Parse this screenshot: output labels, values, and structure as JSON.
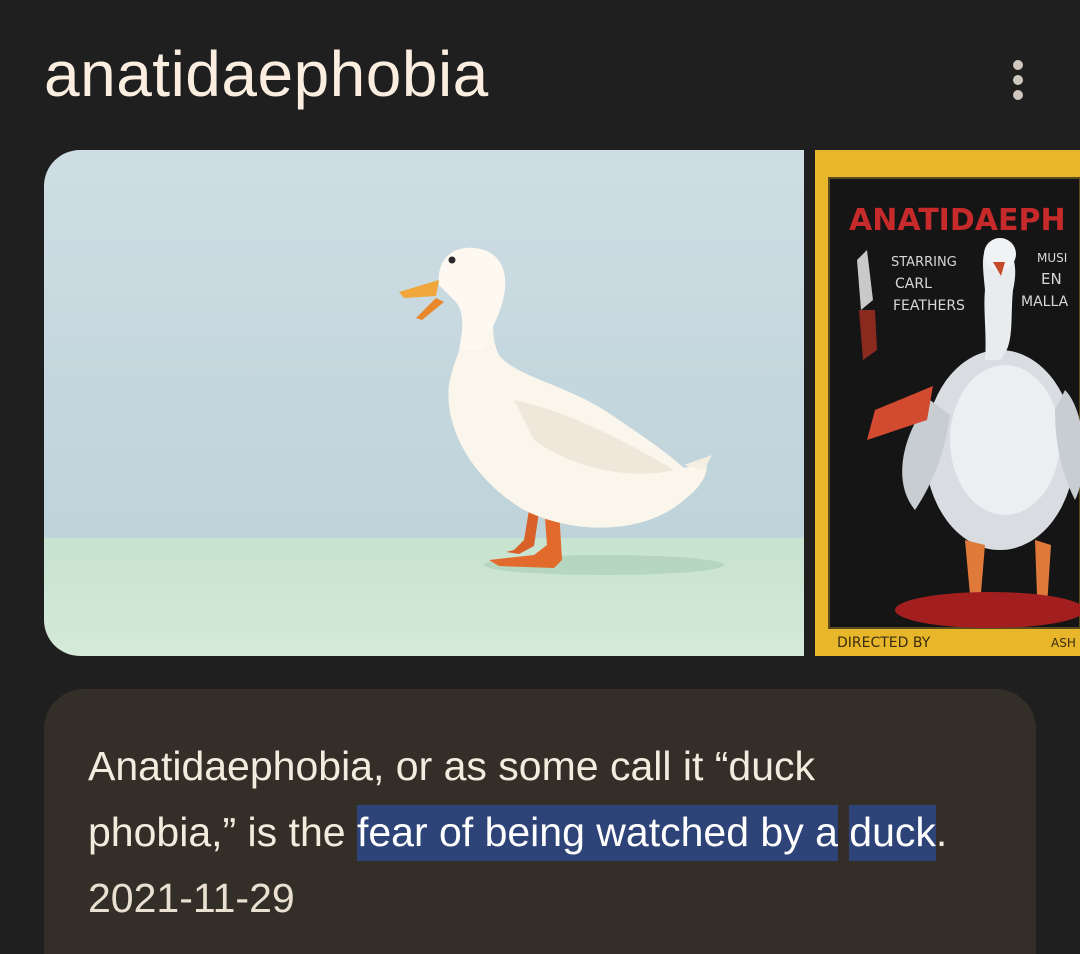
{
  "header": {
    "title": "anatidaephobia",
    "menu_icon": "more-vert-icon"
  },
  "images": {
    "first_alt_icon": "duck-photo",
    "second": {
      "poster_title": "ANATIDAEPH",
      "left_credit_line1": "STARRING",
      "left_credit_line2": "CARL",
      "left_credit_line3": "FEATHERS",
      "right_credit_line1": "MUSI",
      "right_credit_line2": "EN",
      "right_credit_line3": "MALLA",
      "bottom_left": "DIRECTED BY",
      "bottom_right": "ASH"
    }
  },
  "answer": {
    "text_before": "Anatidaephobia, or as some call it “duck phobia,” is the ",
    "highlight_part1": "fear of being watched by a",
    "highlight_part2": "duck",
    "text_after": ".",
    "date": "2021-11-29"
  },
  "colors": {
    "background": "#1f1f1f",
    "card": "#332e27",
    "highlight": "#2e4377",
    "title_text": "#fbeee0"
  }
}
